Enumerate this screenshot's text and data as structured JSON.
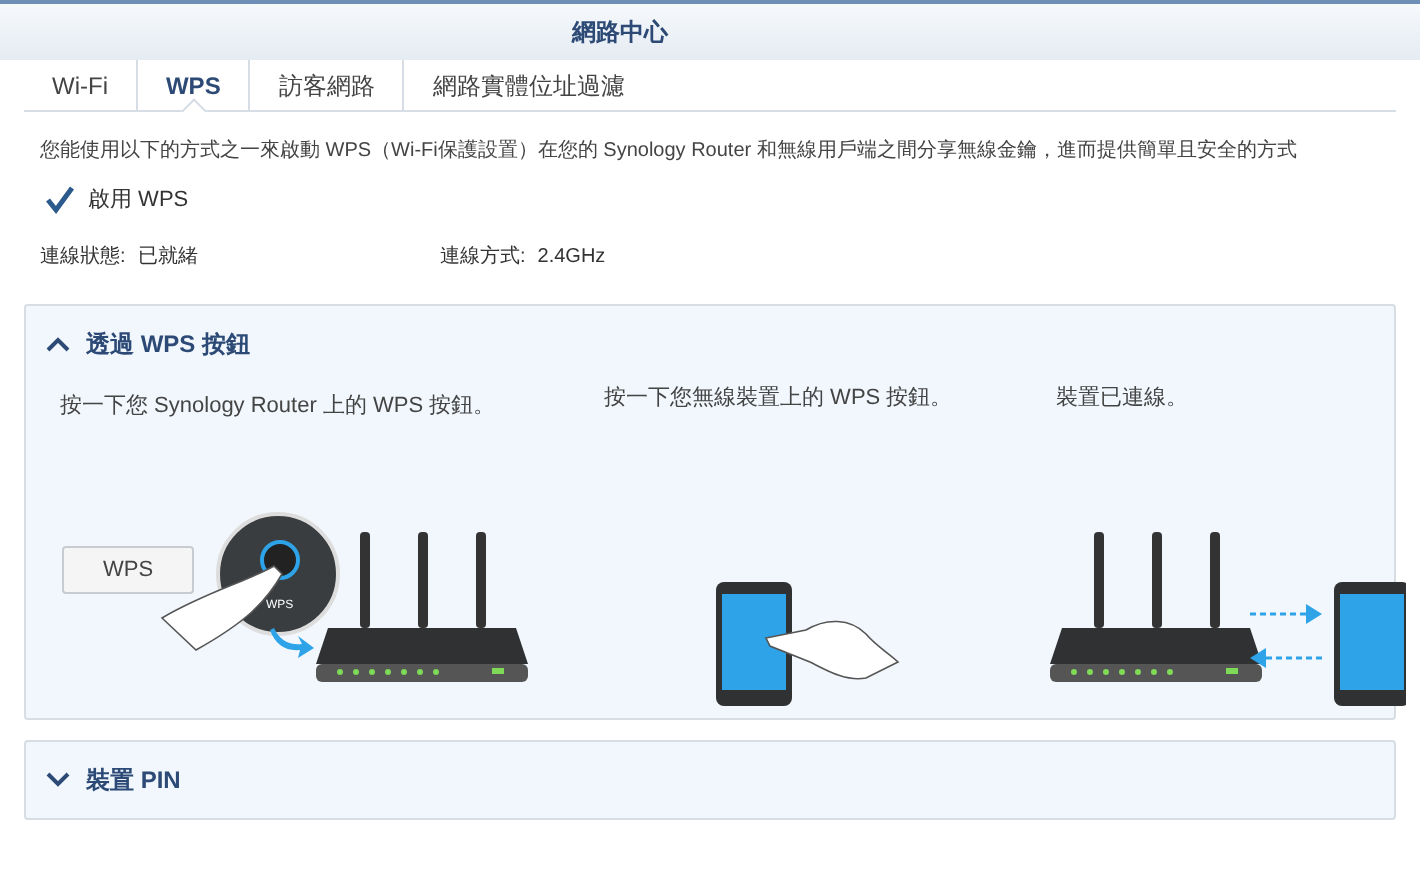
{
  "window": {
    "title": "網路中心"
  },
  "tabs": [
    {
      "label": "Wi-Fi",
      "selected": false
    },
    {
      "label": "WPS",
      "selected": true
    },
    {
      "label": "訪客網路",
      "selected": false
    },
    {
      "label": "網路實體位址過濾",
      "selected": false
    }
  ],
  "description": "您能使用以下的方式之一來啟動 WPS（Wi-Fi保護設置）在您的 Synology Router 和無線用戶端之間分享無線金鑰，進而提供簡單且安全的方式",
  "enable_wps": {
    "label": "啟用 WPS",
    "checked": true
  },
  "status": [
    {
      "label": "連線狀態:",
      "value": "已就緒"
    },
    {
      "label": "連線方式:",
      "value": "2.4GHz"
    }
  ],
  "sections": [
    {
      "title": "透過 WPS 按鈕",
      "expanded": true,
      "steps": [
        "按一下您 Synology Router 上的 WPS 按鈕。",
        "按一下您無線裝置上的 WPS 按鈕。",
        "裝置已連線。"
      ],
      "wps_button": "WPS",
      "inset_label": "WPS"
    },
    {
      "title": "裝置 PIN",
      "expanded": false
    }
  ]
}
